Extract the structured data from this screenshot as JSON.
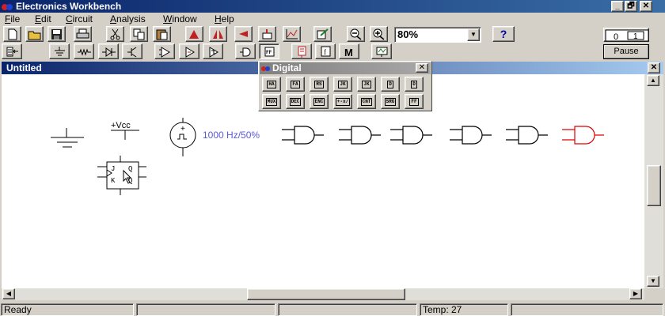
{
  "window": {
    "title": "Electronics Workbench"
  },
  "caption_buttons": [
    "_",
    "🗗",
    "✕"
  ],
  "menu": [
    {
      "label": "File",
      "u": "F",
      "rest": "ile"
    },
    {
      "label": "Edit",
      "u": "E",
      "rest": "dit"
    },
    {
      "label": "Circuit",
      "u": "C",
      "rest": "ircuit"
    },
    {
      "label": "Analysis",
      "u": "A",
      "rest": "nalysis"
    },
    {
      "label": "Window",
      "u": "W",
      "rest": "indow"
    },
    {
      "label": "Help",
      "u": "H",
      "rest": "elp"
    }
  ],
  "toolbar": {
    "zoom_value": "80%",
    "help_label": "?",
    "pause_label": "Pause",
    "buttons": [
      "new-icon",
      "open-icon",
      "save-icon",
      "print-icon",
      "cut-icon",
      "copy-icon",
      "paste-icon",
      "rotate-icon",
      "flip-horizontal-icon",
      "flip-vertical-icon",
      "subcircuit-icon",
      "graph-icon",
      "component-properties-icon",
      "zoom-out-icon",
      "zoom-in-icon"
    ]
  },
  "parts_bin": [
    "favorites-icon",
    "sources-icon",
    "basic-icon",
    "diodes-icon",
    "transistors-icon",
    "analog-ics-icon",
    "mixed-ics-icon",
    "digital-ics-icon",
    "logic-gates-icon",
    "digital-icon",
    "indicators-icon",
    "controls-icon",
    "miscellaneous-icon",
    "instruments-icon"
  ],
  "document": {
    "title": "Untitled",
    "vcc_label": "+Vcc",
    "clock_label": "1000 Hz/50%",
    "ff_pins": {
      "j": "J",
      "k": "K",
      "q": "Q",
      "qn": "Q"
    },
    "gate_colors": [
      "#000000",
      "#000000",
      "#000000",
      "#000000",
      "#000000",
      "#e00000"
    ]
  },
  "digital_palette": {
    "title": "Digital",
    "row1": [
      "HA",
      "FA",
      "RS",
      "JK",
      "JK",
      "D",
      "D"
    ],
    "row2": [
      "MUX",
      "DEC",
      "ENC",
      "+-x/",
      "CNT",
      "SRG",
      "FF"
    ]
  },
  "status": {
    "message": "Ready",
    "temp": "Temp:  27"
  }
}
